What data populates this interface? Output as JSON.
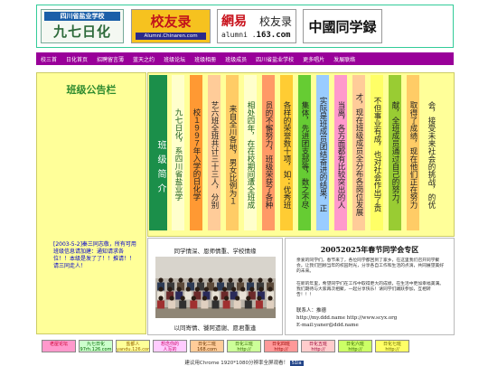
{
  "header": {
    "logos": [
      {
        "top_text": "四川省盐业学校",
        "main_text": "九七日化"
      },
      {
        "main_text": "校友录",
        "sub_text": "Alumni.Chinaren.com"
      },
      {
        "main_text": "網易",
        "main_text2": "校友录",
        "sub_text_pre": "alumni .",
        "sub_text_bold": "163.com"
      },
      {
        "main_text": "中國同学録"
      }
    ]
  },
  "nav": {
    "items": [
      "校三首",
      "日化首页",
      "招聘留言薄",
      "蓝天之约",
      "班级论坛",
      "班级相册",
      "班级成员",
      "四川省盐业学校",
      "更多唱片",
      "发展联络"
    ]
  },
  "left": {
    "title": "班级公告栏",
    "notice": "[2003-5-2]秦三同志敬，所有可用班级信息请加建：通知请求各位！！本级是发了了！！推请！！请三同走人！"
  },
  "intro": {
    "title": "班级简介",
    "columns": [
      {
        "text": "九七日化，系四川省盐业学",
        "bg": "#ffffcc",
        "fg": "#1a5c1a"
      },
      {
        "text": "校１９９７年入学的日化学",
        "bg": "#ff9933",
        "fg": "#222222"
      },
      {
        "text": "艺六班全班共计三十三人，分别",
        "bg": "#ffcc99",
        "fg": "#222222"
      },
      {
        "text": "来自全川各地，男女比例为１",
        "bg": "#ffcc66",
        "fg": "#222222"
      },
      {
        "text": "相处四年，在在校期间遭全班成",
        "bg": "#ffffcc",
        "fg": "#1a5c1a"
      },
      {
        "text": "员的不懈努力，班级荣获了各种",
        "bg": "#ff9966",
        "fg": "#222222"
      },
      {
        "text": "各样的荣誉数十项，如：优秀班",
        "bg": "#ffcc33",
        "fg": "#222222"
      },
      {
        "text": "集体，先进团支部等，数之不尽",
        "bg": "#66cc33",
        "fg": "#222222"
      },
      {
        "text": "实际是班成员团结奋进的结果，正",
        "bg": "#99ccff",
        "fg": "#222222"
      },
      {
        "text": "当离，各方面都有比较突出的人",
        "bg": "#ff99cc",
        "fg": "#222222"
      },
      {
        "text": "才，现在班级成员全分布各岗位发展",
        "bg": "#ffcc99",
        "fg": "#222222"
      },
      {
        "text": "不但事业有成，也对社会作出了贡",
        "bg": "#ffff66",
        "fg": "#222222"
      },
      {
        "text": "献，全班成员通过自己的努力，",
        "bg": "#99cc33",
        "fg": "#222222"
      },
      {
        "text": "取得了成绩，现在他们正在努力",
        "bg": "#ffcc66",
        "fg": "#222222"
      },
      {
        "text": "会，接受未来社会的挑战，的优",
        "bg": "#ffff99",
        "fg": "#222222"
      }
    ]
  },
  "photo": {
    "caption_top": "同学情深、恩师情重、学校情缘",
    "caption_bottom": "以同寄情、饕阿遗谢、愿君重逢"
  },
  "festival": {
    "title": "20052025年春节同学会专区",
    "p1": "亲爱的同学们，春节来了，各位同学都回到了家乡，在这里我们召开同学聚会。让我们回顾当年的校园时光，分享各自工作和生活的点滴，共同展望美好的未来。",
    "p2": "在新的年里，希望同学们在工作中取得更大的成绩，在生活中更加幸福美满。我们期待与大家再次相聚，一起分享快乐！请同学们踊跃参加，互相转告！！！",
    "contact_label": "联系人：推德",
    "links": "http://my.ddd.name  http://www.scyx.org",
    "email": "E-mail:yaner@ddd.name"
  },
  "friends": [
    {
      "label": "老屋论坛",
      "bg": "#ff99cc",
      "fg": "#cc0033"
    },
    {
      "label": "九七日化\n97rh.126.com",
      "bg": "#ccffcc",
      "fg": "#006600"
    },
    {
      "label": "盐都人\nyandu.126.com",
      "bg": "#ffff99",
      "fg": "#996600"
    },
    {
      "label": "想念你的\n人写的",
      "bg": "#ffccff",
      "fg": "#cc0066"
    },
    {
      "label": "日化二班\n168.com",
      "bg": "#ffcc99",
      "fg": "#663300"
    },
    {
      "label": "日化三班\nhttp://",
      "bg": "#ccff99",
      "fg": "#336600"
    },
    {
      "label": "日化四班\nhttp://",
      "bg": "#ff9999",
      "fg": "#990000"
    },
    {
      "label": "日化五班\nhttp://",
      "bg": "#ffcccc",
      "fg": "#990033"
    },
    {
      "label": "日化六班\nhttp://",
      "bg": "#ccff66",
      "fg": "#336600"
    },
    {
      "label": "日化七班\nhttp://",
      "bg": "#ffff66",
      "fg": "#666600"
    }
  ],
  "footer": {
    "text": "建议用Chrome 1920*1080分辨率全屏观看！",
    "badge": "51la"
  }
}
